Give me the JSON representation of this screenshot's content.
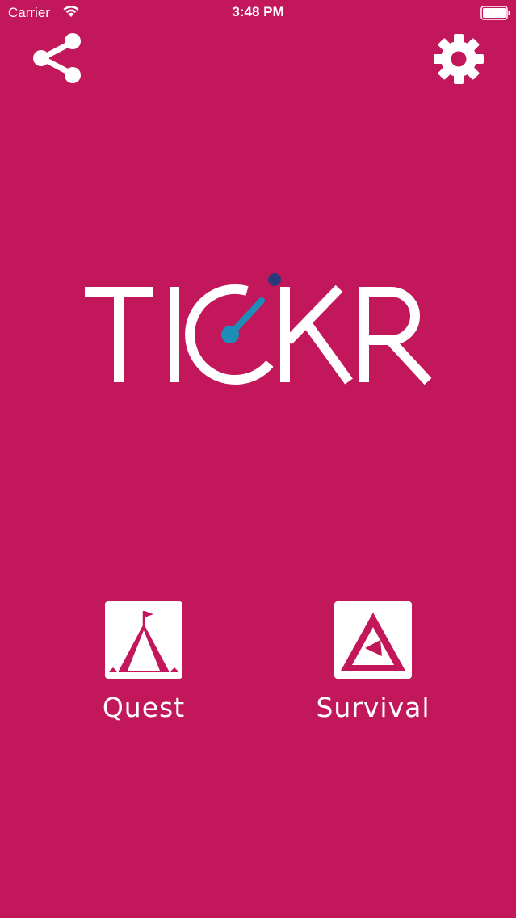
{
  "status_bar": {
    "carrier": "Carrier",
    "time": "3:48 PM"
  },
  "colors": {
    "background": "#C2185B",
    "foreground": "#FFFFFF",
    "logo_accent": "#1E8DB8",
    "logo_dot": "#283A7A"
  },
  "header": {
    "share_icon": "share-icon",
    "settings_icon": "gear-icon"
  },
  "logo": {
    "text": "TICKR"
  },
  "modes": [
    {
      "label": "Quest",
      "icon": "tent-flag-icon"
    },
    {
      "label": "Survival",
      "icon": "triangle-icon"
    }
  ]
}
